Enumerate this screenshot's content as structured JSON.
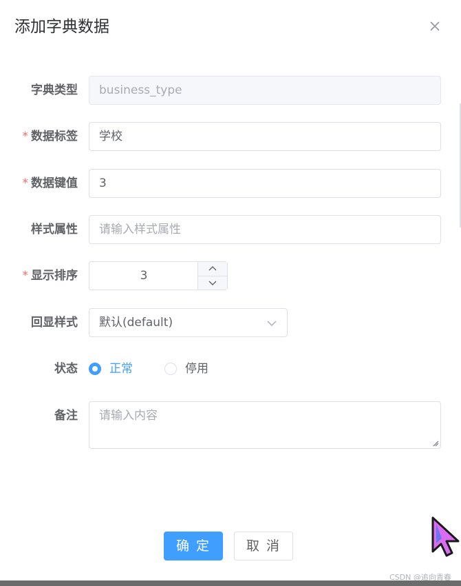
{
  "dialog": {
    "title": "添加字典数据",
    "close_icon": "close-icon"
  },
  "form": {
    "dict_type": {
      "label": "字典类型",
      "value": "business_type",
      "required": false,
      "disabled": true
    },
    "dict_label": {
      "label": "数据标签",
      "value": "学校",
      "required": true
    },
    "dict_value": {
      "label": "数据键值",
      "value": "3",
      "required": true
    },
    "css_class": {
      "label": "样式属性",
      "placeholder": "请输入样式属性",
      "value": ""
    },
    "sort": {
      "label": "显示排序",
      "value": "3",
      "required": true
    },
    "list_class": {
      "label": "回显样式",
      "value": "默认(default)"
    },
    "status": {
      "label": "状态",
      "options": [
        {
          "label": "正常",
          "checked": true
        },
        {
          "label": "停用",
          "checked": false
        }
      ]
    },
    "remark": {
      "label": "备注",
      "placeholder": "请输入内容",
      "value": ""
    }
  },
  "footer": {
    "confirm_label": "确 定",
    "cancel_label": "取 消"
  },
  "watermark": "CSDN @追向青春",
  "colors": {
    "primary": "#409eff",
    "required": "#f56c6c",
    "text": "#606266",
    "title": "#303133",
    "placeholder": "#a8abb2",
    "border": "#dcdfe6",
    "disabled_bg": "#f5f7fa"
  }
}
